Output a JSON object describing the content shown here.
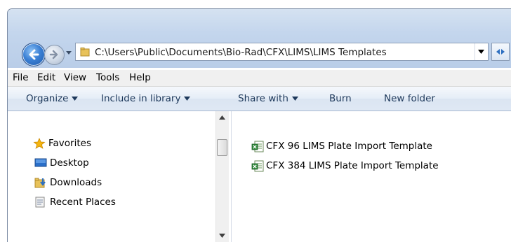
{
  "address_bar": {
    "path": "C:\\Users\\Public\\Documents\\Bio-Rad\\CFX\\LIMS\\LIMS Templates"
  },
  "menu": [
    "File",
    "Edit",
    "View",
    "Tools",
    "Help"
  ],
  "toolbar": {
    "organize": "Organize",
    "include_in_library": "Include in library",
    "share_with": "Share with",
    "burn": "Burn",
    "new_folder": "New folder"
  },
  "nav_pane": {
    "favorites": "Favorites",
    "items": [
      "Desktop",
      "Downloads",
      "Recent Places"
    ]
  },
  "files": [
    {
      "name": "CFX 96 LIMS Plate Import Template",
      "icon": "excel-csv-file-icon"
    },
    {
      "name": "CFX 384 LIMS Plate Import Template",
      "icon": "excel-csv-file-icon"
    }
  ]
}
